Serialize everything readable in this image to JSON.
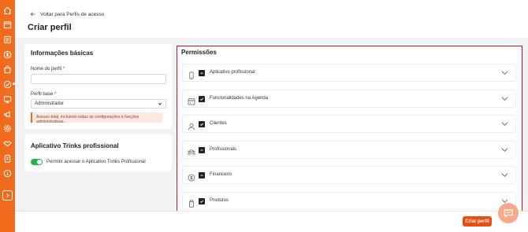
{
  "header": {
    "back_label": "Voltar para Perfis de acesso",
    "title": "Criar perfil"
  },
  "basic": {
    "title": "Informações básicas",
    "name_label": "Nome do perfil",
    "name_value": "",
    "base_label": "Perfil base",
    "base_selected": "Administrador",
    "note": "Acesso total, incluindo todas as configurações e funções administrativas.",
    "required_mark": "*"
  },
  "app": {
    "title": "Aplicativo Trinks profissional",
    "toggle_label": "Permitir acessar o Aplicativo Trinks Profissional",
    "toggle_on": true
  },
  "permissions": {
    "title": "Permissões",
    "items": [
      {
        "label": "Aplicativo profissional",
        "icon": "phone-icon",
        "state": "partial"
      },
      {
        "label": "Funcionalidades na Agenda",
        "icon": "calendar-icon",
        "state": "checked"
      },
      {
        "label": "Clientes",
        "icon": "user-icon",
        "state": "checked"
      },
      {
        "label": "Profissionais",
        "icon": "team-icon",
        "state": "partial"
      },
      {
        "label": "Financeiro",
        "icon": "money-icon",
        "state": "partial"
      },
      {
        "label": "Produtos",
        "icon": "product-icon",
        "state": "checked"
      }
    ]
  },
  "footer": {
    "create_label": "Criar perfil"
  },
  "colors": {
    "brand": "#f26b1d",
    "button": "#e94e0f",
    "highlight": "#e0101a",
    "toggle": "#2db24a"
  }
}
